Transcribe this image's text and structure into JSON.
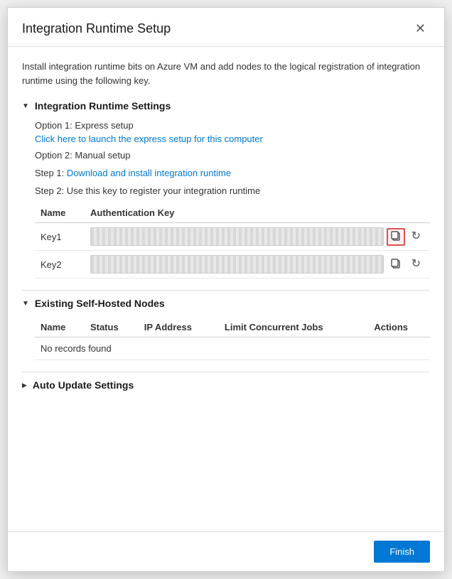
{
  "dialog": {
    "title": "Integration Runtime Setup",
    "close_label": "✕"
  },
  "intro": {
    "text": "Install integration runtime bits on Azure VM and add nodes to the logical registration of integration runtime using the following key."
  },
  "runtime_settings": {
    "section_title": "Integration Runtime Settings",
    "triangle": "▼",
    "option1": {
      "label": "Option 1: Express setup",
      "link_text": "Click here to launch the express setup for this computer"
    },
    "option2": {
      "label": "Option 2: Manual setup",
      "step1_prefix": "Step 1: ",
      "step1_link": "Download and install integration runtime",
      "step2_text": "Step 2: Use this key to register your integration runtime"
    },
    "key_table": {
      "col_name": "Name",
      "col_auth_key": "Authentication Key",
      "rows": [
        {
          "name": "Key1"
        },
        {
          "name": "Key2"
        }
      ]
    }
  },
  "nodes_section": {
    "section_title": "Existing Self-Hosted Nodes",
    "triangle": "▼",
    "col_name": "Name",
    "col_status": "Status",
    "col_ip": "IP Address",
    "col_limit": "Limit Concurrent Jobs",
    "col_actions": "Actions",
    "no_records": "No records found"
  },
  "auto_update_section": {
    "section_title": "Auto Update Settings",
    "triangle": "▶"
  },
  "footer": {
    "finish_label": "Finish"
  },
  "icons": {
    "copy": "⧉",
    "refresh": "↻",
    "close": "✕"
  }
}
